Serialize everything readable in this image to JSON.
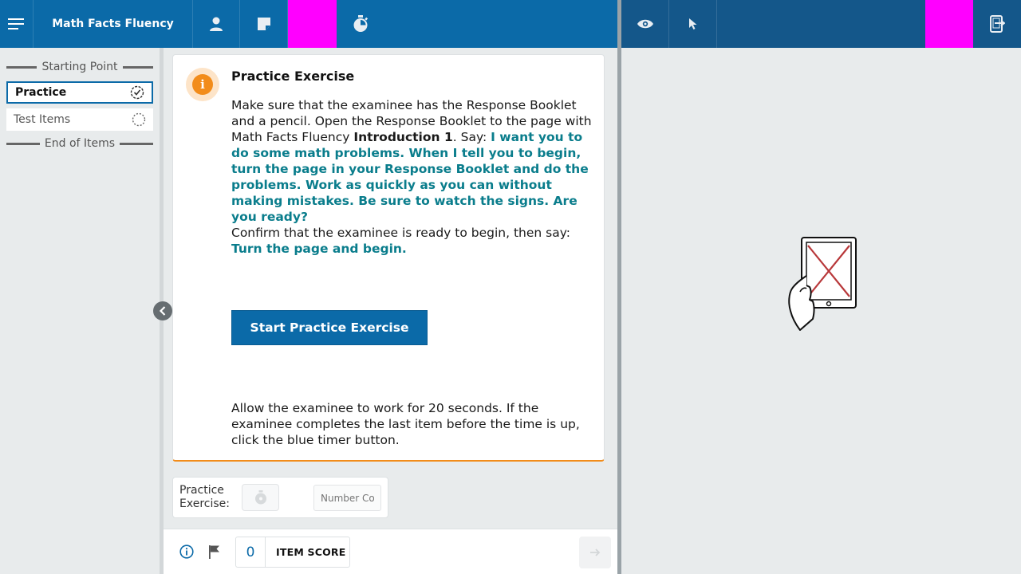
{
  "header": {
    "title": "Math Facts Fluency",
    "icons": [
      "menu-icon",
      "person-icon",
      "note-icon",
      "stopwatch-icon",
      "eye-icon",
      "pointer-icon",
      "exit-device-icon"
    ],
    "highlight_color": "#ff00ff",
    "bar_color": "#0b6aa8",
    "bar_color_right": "#14578a"
  },
  "sidebar": {
    "starting_point": "Starting Point",
    "items": [
      {
        "label": "Practice",
        "state": "active"
      },
      {
        "label": "Test Items",
        "state": "pending"
      }
    ],
    "end_label": "End of Items"
  },
  "card": {
    "title": "Practice Exercise",
    "p1_a": "Make sure that the examinee has the Response Booklet and a pencil. Open the Response Booklet to the page with Math Facts Fluency ",
    "p1_bold": "Introduction 1",
    "p1_b": ". Say: ",
    "p1_script": "I want you to do some math problems. When I tell you to begin, turn the page in your Response Booklet and do the problems. Work as quickly as you can without making mistakes. Be sure to watch the signs. Are you ready?",
    "p2_a": "Confirm that the examinee is ready to begin, then say: ",
    "p2_script": "Turn the page and begin.",
    "start_button": "Start Practice Exercise",
    "p3": "Allow the examinee to work for 20 seconds. If the examinee completes the last item before the time is up, click the blue timer button.",
    "accent_color": "#f28c1a",
    "script_color": "#0a7d8c"
  },
  "practice": {
    "label_line1": "Practice",
    "label_line2": "Exercise:",
    "number_placeholder": "Number Correct"
  },
  "footer": {
    "item_score_value": "0",
    "item_score_label": "ITEM SCORE"
  }
}
